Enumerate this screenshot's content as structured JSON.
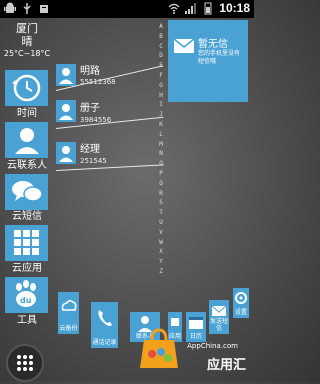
{
  "status_bar": {
    "time": "10:18",
    "left_icons": [
      "android-icon",
      "usb-icon",
      "android-debug-icon"
    ],
    "right_icons": [
      "wifi-icon",
      "signal-icon",
      "battery-icon"
    ]
  },
  "weather": {
    "city": "厦门",
    "condition": "晴",
    "temperature": "25°C~18°C"
  },
  "left_tiles": [
    {
      "label": "时间",
      "icon": "clock-icon"
    },
    {
      "label": "云联系人",
      "icon": "person-icon"
    },
    {
      "label": "云短信",
      "icon": "chat-icon"
    },
    {
      "label": "云应用",
      "icon": "apps-grid-icon"
    },
    {
      "label": "工具",
      "icon": "baidu-paw-icon"
    }
  ],
  "contacts": [
    {
      "name": "明路",
      "number": "5551236​8"
    },
    {
      "name": "册子",
      "number": "3984556"
    },
    {
      "name": "经理",
      "number": "251545"
    }
  ],
  "alphabet": [
    "A",
    "B",
    "C",
    "D",
    "E",
    "F",
    "G",
    "H",
    "I",
    "J",
    "K",
    "L",
    "M",
    "N",
    "O",
    "P",
    "Q",
    "R",
    "S",
    "T",
    "U",
    "V",
    "W",
    "X",
    "Y",
    "Z"
  ],
  "sms_card": {
    "title": "暂无信",
    "subtitle": "您的手机里没有短信哦"
  },
  "bottom_tiles": [
    {
      "label": "云备份",
      "icon": "cloud-backup-icon"
    },
    {
      "label": "通话记录",
      "icon": "phone-icon"
    },
    {
      "label": "联系人",
      "icon": "person-icon"
    },
    {
      "label": "应用",
      "icon": "app-icon"
    },
    {
      "label": "日历",
      "icon": "calendar-icon"
    },
    {
      "label": "发送短信",
      "icon": "message-icon"
    },
    {
      "label": "设置",
      "icon": "settings-icon"
    }
  ],
  "watermark": {
    "brand": "应用汇",
    "url": "AppChina.com"
  },
  "colors": {
    "tile_blue": "#4aa2d4",
    "background": "#555555",
    "status_bar": "#000000"
  }
}
